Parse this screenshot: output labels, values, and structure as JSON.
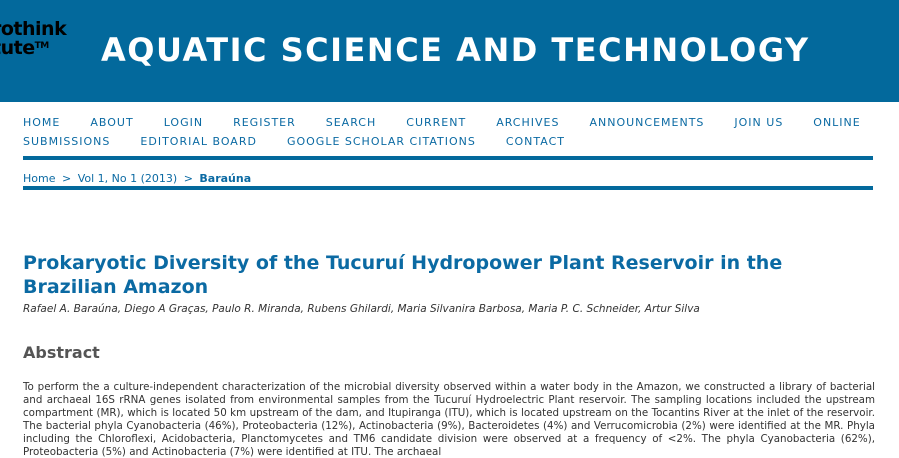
{
  "header": {
    "logo_line1": "rothink",
    "logo_line2": "tute",
    "logo_tm": "TM",
    "site_title": "AQUATIC SCIENCE AND TECHNOLOGY"
  },
  "nav": {
    "row1": [
      "HOME",
      "ABOUT",
      "LOGIN",
      "REGISTER",
      "SEARCH",
      "CURRENT",
      "ARCHIVES",
      "ANNOUNCEMENTS",
      "JOIN US",
      "ONLINE"
    ],
    "row2": [
      "SUBMISSIONS",
      "EDITORIAL BOARD",
      "GOOGLE SCHOLAR CITATIONS",
      "CONTACT"
    ]
  },
  "breadcrumb": {
    "home": "Home",
    "issue": "Vol 1, No 1 (2013)",
    "current": "Baraúna",
    "separator": ">"
  },
  "article": {
    "title": "Prokaryotic Diversity of the Tucuruí Hydropower Plant Reservoir in the Brazilian Amazon",
    "authors": "Rafael A. Baraúna, Diego A Graças, Paulo R. Miranda, Rubens Ghilardi, Maria Silvanira Barbosa, Maria P. C. Schneider, Artur Silva",
    "abstract_heading": "Abstract",
    "abstract_text": "To perform the a culture-independent characterization of the microbial diversity observed within a water body in the Amazon, we constructed a library of bacterial and archaeal 16S rRNA genes isolated from environmental samples from the Tucuruí Hydroelectric Plant reservoir. The sampling locations included the upstream compartment (MR), which is located 50 km upstream of the dam, and Itupiranga (ITU), which is located upstream on the Tocantins River at the inlet of the reservoir. The bacterial phyla Cyanobacteria (46%), Proteobacteria (12%), Actinobacteria (9%), Bacteroidetes (4%) and Verrucomicrobia (2%) were identified at the MR. Phyla including the Chloroflexi, Acidobacteria, Planctomycetes and TM6 candidate division were observed at a frequency of <2%. The phyla Cyanobacteria (62%), Proteobacteria (5%) and Actinobacteria (7%) were identified at ITU. The archaeal"
  },
  "colors": {
    "header_bg": "#03699c",
    "link": "#0b6aa3",
    "rule": "#03699c"
  }
}
